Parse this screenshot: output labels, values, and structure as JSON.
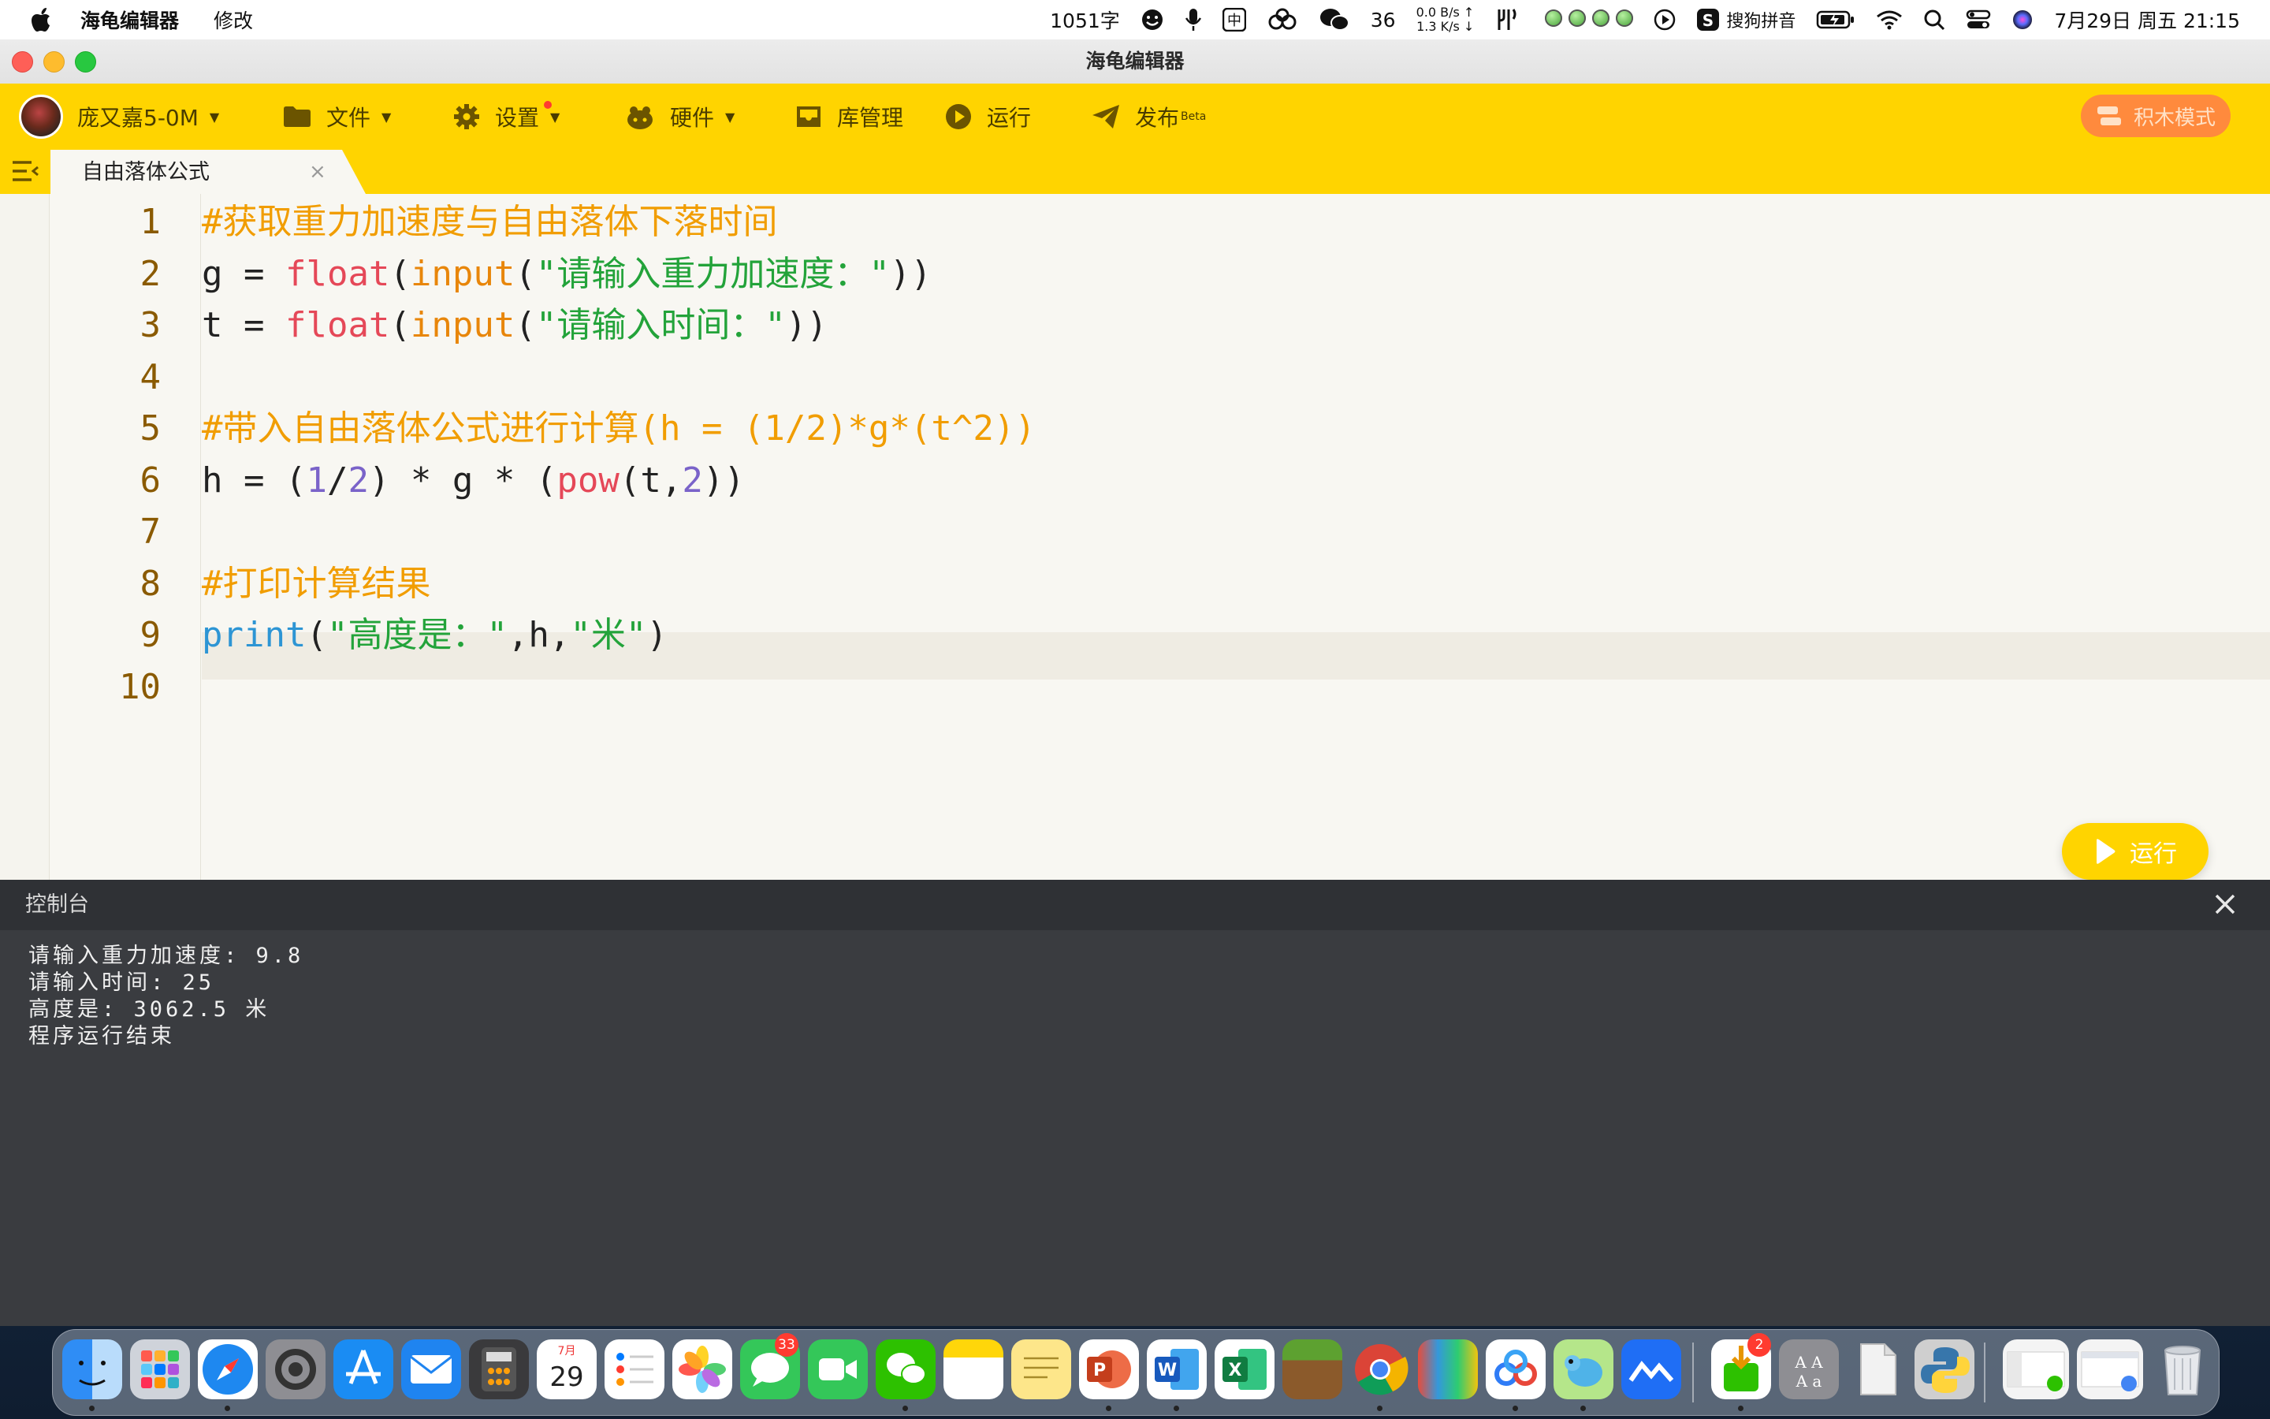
{
  "menubar": {
    "app_name": "海龟编辑器",
    "menu_edit": "修改",
    "word_count": "1051字",
    "chat_count": "36",
    "net_up": "0.0 B/s ↑",
    "net_down": "1.3 K/s ↓",
    "input_method": "搜狗拼音",
    "datetime": "7月29日 周五 21:15",
    "zh_indicator": "中"
  },
  "window": {
    "title": "海龟编辑器"
  },
  "toolbar": {
    "user": "庞又嘉5-0M",
    "file": "文件",
    "settings": "设置",
    "hardware": "硬件",
    "library": "库管理",
    "run": "运行",
    "publish": "发布",
    "publish_badge": "Beta",
    "block_mode": "积木模式"
  },
  "tab": {
    "name": "自由落体公式",
    "close": "×"
  },
  "editor": {
    "line_numbers": [
      "1",
      "2",
      "3",
      "4",
      "5",
      "6",
      "7",
      "8",
      "9",
      "10"
    ],
    "lines": [
      [
        {
          "t": "#获取重力加速度与自由落体下落时间",
          "c": "com"
        }
      ],
      [
        {
          "t": "g = ",
          "c": "plain"
        },
        {
          "t": "float",
          "c": "fn"
        },
        {
          "t": "(",
          "c": "plain"
        },
        {
          "t": "input",
          "c": "bi"
        },
        {
          "t": "(",
          "c": "plain"
        },
        {
          "t": "\"请输入重力加速度：\"",
          "c": "str"
        },
        {
          "t": "))",
          "c": "plain"
        }
      ],
      [
        {
          "t": "t = ",
          "c": "plain"
        },
        {
          "t": "float",
          "c": "fn"
        },
        {
          "t": "(",
          "c": "plain"
        },
        {
          "t": "input",
          "c": "bi"
        },
        {
          "t": "(",
          "c": "plain"
        },
        {
          "t": "\"请输入时间：\"",
          "c": "str"
        },
        {
          "t": "))",
          "c": "plain"
        }
      ],
      [],
      [
        {
          "t": "#带入自由落体公式进行计算(h = (1/2)*g*(t^2))",
          "c": "com"
        }
      ],
      [
        {
          "t": "h = (",
          "c": "plain"
        },
        {
          "t": "1",
          "c": "num"
        },
        {
          "t": "/",
          "c": "plain"
        },
        {
          "t": "2",
          "c": "num"
        },
        {
          "t": ") * g * (",
          "c": "plain"
        },
        {
          "t": "pow",
          "c": "fn"
        },
        {
          "t": "(t,",
          "c": "plain"
        },
        {
          "t": "2",
          "c": "num"
        },
        {
          "t": "))",
          "c": "plain"
        }
      ],
      [],
      [
        {
          "t": "#打印计算结果",
          "c": "com"
        }
      ],
      [
        {
          "t": "print",
          "c": "kw"
        },
        {
          "t": "(",
          "c": "plain"
        },
        {
          "t": "\"高度是：\"",
          "c": "str"
        },
        {
          "t": ",h,",
          "c": "plain"
        },
        {
          "t": "\"米\"",
          "c": "str"
        },
        {
          "t": ")",
          "c": "plain"
        }
      ],
      []
    ],
    "run_button": "运行"
  },
  "console": {
    "title": "控制台",
    "lines": [
      "请输入重力加速度: 9.8",
      "请输入时间: 25",
      "高度是:  3062.5 米",
      "程序运行结束"
    ]
  },
  "dock": {
    "calendar_month": "7月",
    "calendar_day": "29",
    "messages_badge": "33",
    "appstore_badge": "2",
    "items": [
      "finder-icon",
      "launchpad-icon",
      "safari-icon",
      "system-settings-icon",
      "app-store-icon",
      "mail-icon",
      "calculator-icon",
      "calendar-icon",
      "reminders-icon",
      "photos-icon",
      "messages-icon",
      "facetime-icon",
      "wechat-icon",
      "notes-icon",
      "stickies-icon",
      "powerpoint-icon",
      "word-icon",
      "excel-icon",
      "minecraft-icon",
      "chrome-icon",
      "books-stack-icon",
      "baidu-netdisk-icon",
      "turtle-editor-icon",
      "lanhu-icon",
      "app-installer-icon",
      "dictionary-icon",
      "document-icon",
      "python-launcher-icon",
      "wechat-window-icon",
      "chrome-window-icon",
      "trash-icon"
    ]
  },
  "colors": {
    "toolbar": "#ffd400",
    "comment": "#f19d00",
    "function": "#e54858",
    "builtin": "#e8860a",
    "string": "#23a33a",
    "number": "#7a63c9",
    "keyword": "#2d95d4",
    "block_mode": "#ff8a3d",
    "console_bg": "#3a3c40"
  }
}
